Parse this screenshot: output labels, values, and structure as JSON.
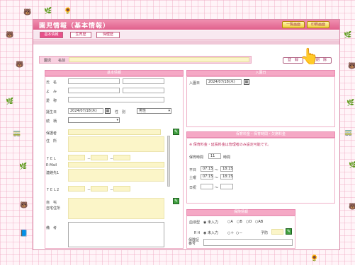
{
  "window_title": "園児情報（基本情報）",
  "top_buttons": {
    "list_label": "一覧画面",
    "print_label": "印刷画面"
  },
  "tabs": [
    {
      "label": "基本情報"
    },
    {
      "label": "生育歴"
    },
    {
      "label": "保健歴"
    }
  ],
  "name_row": {
    "tag": "園児",
    "label": "名前",
    "value": ""
  },
  "actions": {
    "register_label": "登　録",
    "delete_label": "削　除"
  },
  "basic_info": {
    "header": "基本情報",
    "fields": {
      "name": "氏　名",
      "kana": "よ　み",
      "nickname": "愛　称",
      "birth": "誕生日",
      "birth_value": "2024/07/18(木)",
      "gender": "性　別",
      "gender_value": "男性",
      "relation": "続　柄",
      "guardian": "保護者",
      "address": "住　所",
      "tel": "ＴＥＬ",
      "email": "E-Mail",
      "contact": "連絡先1",
      "tel2": "ＴＥＬ2",
      "commute": "自　宅",
      "commute2": "自宅住所",
      "remarks": "備　考"
    },
    "dash": "－"
  },
  "enrollment": {
    "header": "入園日",
    "label": "入園日",
    "date_value": "2024/07/18(木)"
  },
  "fees": {
    "header": "保育料金・保育時間・欠席料金",
    "note": "※ 保育料金・延長料金は管理者のみ設定可能です。",
    "hours_label": "保育時間",
    "hours_value": "11",
    "hours_unit": "時間",
    "weekday": "平日",
    "saturday": "土曜",
    "holiday": "日祝",
    "weekday_start": "07:15",
    "weekday_end": "18:15",
    "saturday_start": "07:15",
    "saturday_end": "18:15",
    "sep": "～"
  },
  "health": {
    "header": "保険情報",
    "blood_label": "血液型",
    "blood_options": [
      "◉ 未入力",
      "○A",
      "○B",
      "○O",
      "○AB"
    ],
    "rh_label": "ＲＨ",
    "rh_options": [
      "◉ 未入力",
      "○＋",
      "○－"
    ],
    "period_label": "予防",
    "insurance_label": "保険証番号"
  }
}
